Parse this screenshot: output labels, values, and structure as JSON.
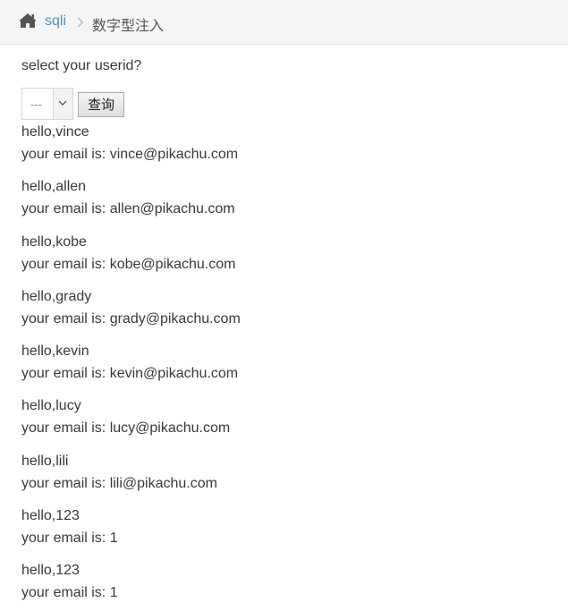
{
  "breadcrumb": {
    "home_icon": "home-icon",
    "home_label": "sqli",
    "separator_icon": "chevron-right-icon",
    "current": "数字型注入"
  },
  "form": {
    "prompt": "select your userid?",
    "select_value": "---",
    "submit_label": "查询"
  },
  "results": [
    {
      "hello": "hello,vince",
      "email": "your email is: vince@pikachu.com"
    },
    {
      "hello": "hello,allen",
      "email": "your email is: allen@pikachu.com"
    },
    {
      "hello": "hello,kobe",
      "email": "your email is: kobe@pikachu.com"
    },
    {
      "hello": "hello,grady",
      "email": "your email is: grady@pikachu.com"
    },
    {
      "hello": "hello,kevin",
      "email": "your email is: kevin@pikachu.com"
    },
    {
      "hello": "hello,lucy",
      "email": "your email is: lucy@pikachu.com"
    },
    {
      "hello": "hello,lili",
      "email": "your email is: lili@pikachu.com"
    },
    {
      "hello": "hello,123",
      "email": "your email is: 1"
    },
    {
      "hello": "hello,123",
      "email": "your email is: 1"
    }
  ],
  "colors": {
    "link": "#4c8fbd",
    "text": "#393939",
    "breadcrumb_bg": "#f5f5f5"
  }
}
